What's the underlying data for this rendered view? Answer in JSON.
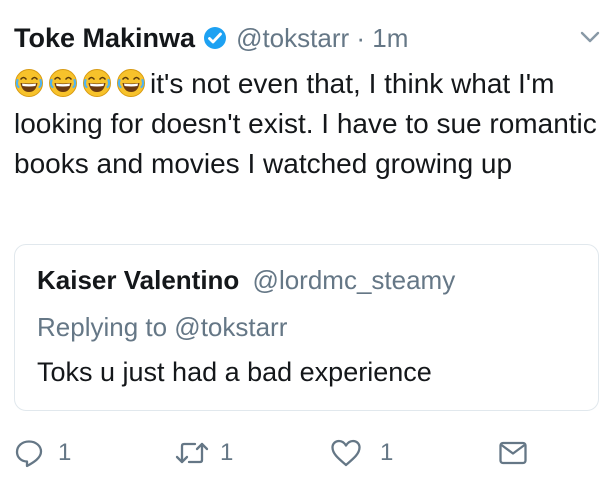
{
  "tweet": {
    "author_name": "Toke Makinwa",
    "author_handle": "@tokstarr",
    "separator": "·",
    "time": "1m",
    "verified_icon": "verified-badge-icon",
    "emoji_count": 4,
    "emoji_icon": "face-with-tears-of-joy-emoji",
    "text": "it's not even that, I think what I'm looking for doesn't exist. I have to sue romantic books and movies I watched growing up"
  },
  "quoted_tweet": {
    "author_name": "Kaiser Valentino",
    "author_handle": "@lordmc_steamy",
    "replying_to": "Replying to @tokstarr",
    "text": "Toks u just had a bad experience"
  },
  "actions": {
    "reply_count": "1",
    "retweet_count": "1",
    "like_count": "1"
  },
  "colors": {
    "text": "#14171a",
    "secondary": "#657786",
    "verified": "#1da1f2",
    "border": "#e1e8ed"
  }
}
